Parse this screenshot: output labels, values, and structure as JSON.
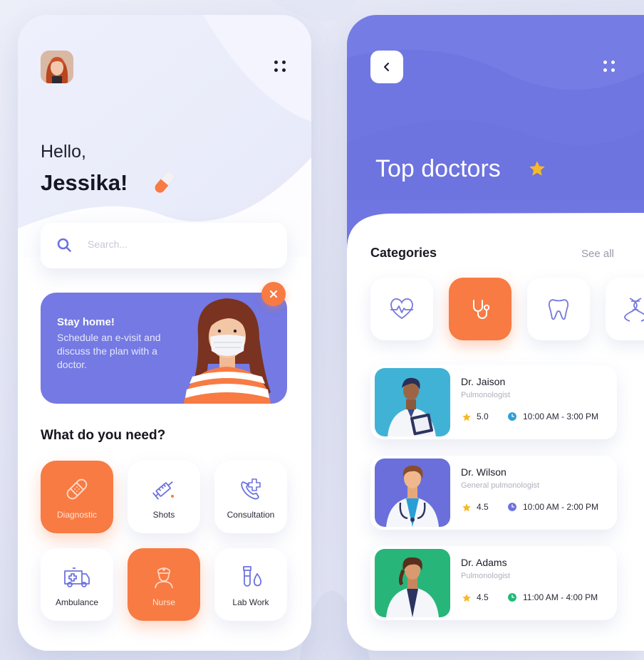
{
  "home": {
    "greeting": "Hello,",
    "user_name": "Jessika!",
    "search": {
      "placeholder": "Search..."
    },
    "banner": {
      "title": "Stay home!",
      "body": "Schedule an e-visit and discuss the plan with a doctor."
    },
    "section_title": "What do you need?",
    "services": [
      {
        "label": "Diagnostic",
        "icon": "bandage-icon",
        "active": true
      },
      {
        "label": "Shots",
        "icon": "syringe-icon",
        "active": false
      },
      {
        "label": "Consultation",
        "icon": "phone-plus-icon",
        "active": false
      },
      {
        "label": "Ambulance",
        "icon": "ambulance-icon",
        "active": false
      },
      {
        "label": "Nurse",
        "icon": "nurse-icon",
        "active": true
      },
      {
        "label": "Lab Work",
        "icon": "test-tube-icon",
        "active": false
      }
    ]
  },
  "doctors_screen": {
    "title": "Top doctors",
    "categories_title": "Categories",
    "see_all": "See all",
    "categories": [
      {
        "icon": "heart-pulse-icon",
        "active": false
      },
      {
        "icon": "stethoscope-icon",
        "active": true
      },
      {
        "icon": "tooth-icon",
        "active": false
      },
      {
        "icon": "dna-icon",
        "active": false
      }
    ],
    "doctors": [
      {
        "name": "Dr. Jaison",
        "specialty": "Pulmonologist",
        "rating": "5.0",
        "hours": "10:00 AM - 3:00 PM",
        "clock_color": "#2e9fd6"
      },
      {
        "name": "Dr. Wilson",
        "specialty": "General pulmonologist",
        "rating": "4.5",
        "hours": "10:00 AM - 2:00 PM",
        "clock_color": "#6d72e0"
      },
      {
        "name": "Dr. Adams",
        "specialty": "Pulmonologist",
        "rating": "4.5",
        "hours": "11:00 AM - 4:00 PM",
        "clock_color": "#1fb978"
      }
    ]
  },
  "colors": {
    "accent_orange": "#f77b43",
    "accent_purple": "#7479e3",
    "star_yellow": "#f7b928"
  }
}
